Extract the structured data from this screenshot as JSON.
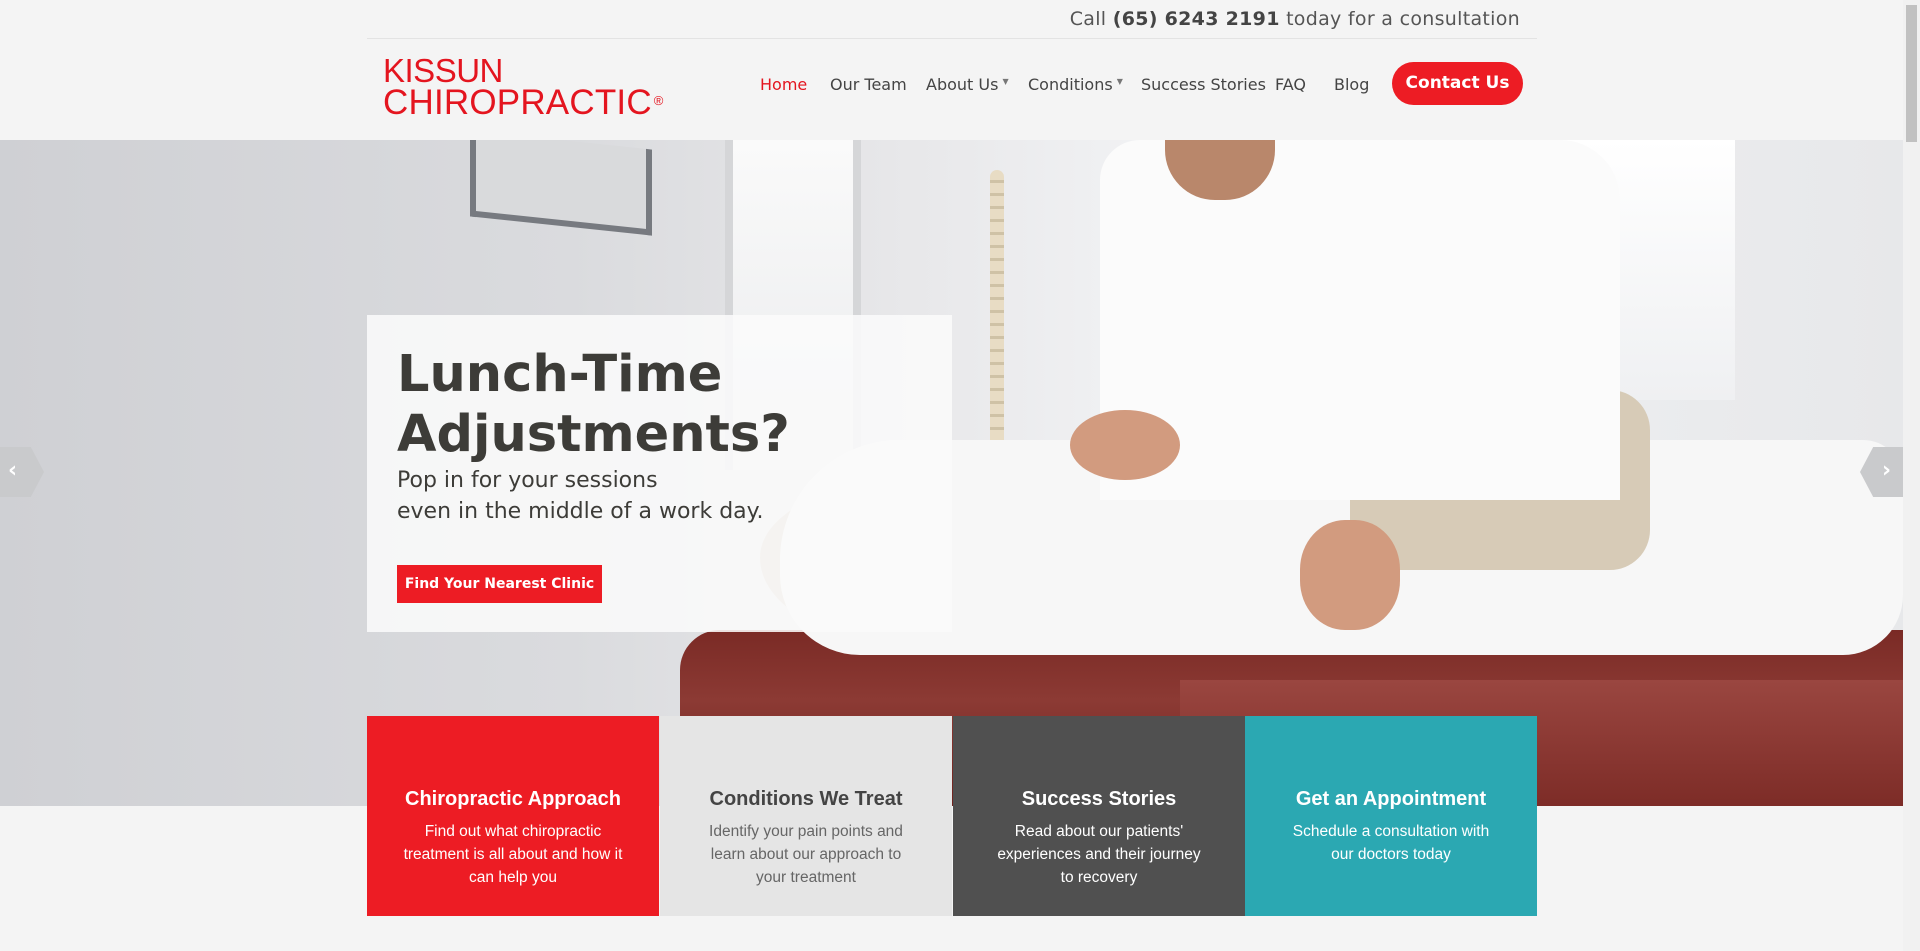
{
  "header": {
    "call_prefix": "Call",
    "phone": "(65) 6243 2191",
    "call_suffix": "today for a consultation",
    "logo_line1": "KISSUN",
    "logo_line2": "CHIROPRACTIC",
    "logo_mark": "®"
  },
  "nav": {
    "items": [
      {
        "label": "Home"
      },
      {
        "label": "Our Team"
      },
      {
        "label": "About Us"
      },
      {
        "label": "Conditions"
      },
      {
        "label": "Success Stories"
      },
      {
        "label": "FAQ"
      },
      {
        "label": "Blog"
      }
    ],
    "caret": "▼",
    "contact_label": "Contact Us"
  },
  "hero": {
    "title_line1": "Lunch-Time",
    "title_line2": "Adjustments?",
    "subtitle_line1": "Pop in for your sessions",
    "subtitle_line2": "even in the middle of a work day.",
    "button_label": "Find Your Nearest Clinic",
    "prev_icon": "‹",
    "next_icon": "›"
  },
  "tiles": [
    {
      "title": "Chiropractic Approach",
      "text": "Find out what chiropractic treatment is all about and how it can help you",
      "color": "#ed1c24"
    },
    {
      "title": "Conditions We Treat",
      "text": "Identify your pain points and learn about our approach to your treatment",
      "color": "#e5e5e5"
    },
    {
      "title": "Success Stories",
      "text": "Read about our patients' experiences and their journey to recovery",
      "color": "#505050"
    },
    {
      "title": "Get an Appointment",
      "text": "Schedule a consultation with our doctors today",
      "color": "#2ba8b2"
    }
  ],
  "colors": {
    "brand_red": "#ed1c24",
    "teal": "#2ba8b2",
    "dark": "#505050"
  }
}
